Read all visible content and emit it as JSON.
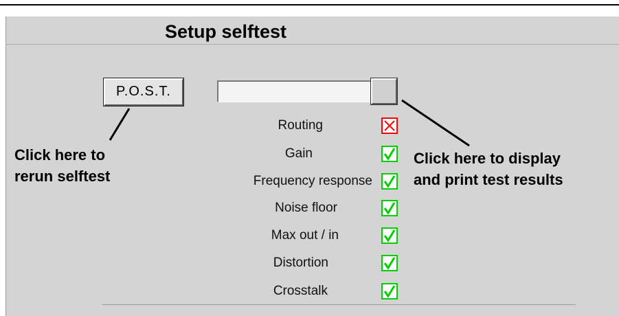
{
  "window": {
    "title": "Setup selftest"
  },
  "controls": {
    "post_button_label": "P.O.S.T.",
    "test_progress": 1.0
  },
  "tests": [
    {
      "label": "Routing",
      "status": "fail",
      "icon": "x-mark-icon",
      "color": "#ff0000"
    },
    {
      "label": "Gain",
      "status": "pass",
      "icon": "check-mark-icon",
      "color": "#00d000"
    },
    {
      "label": "Frequency response",
      "status": "pass",
      "icon": "check-mark-icon",
      "color": "#00d000"
    },
    {
      "label": "Noise floor",
      "status": "pass",
      "icon": "check-mark-icon",
      "color": "#00d000"
    },
    {
      "label": "Max out / in",
      "status": "pass",
      "icon": "check-mark-icon",
      "color": "#00d000"
    },
    {
      "label": "Distortion",
      "status": "pass",
      "icon": "check-mark-icon",
      "color": "#00d000"
    },
    {
      "label": "Crosstalk",
      "status": "pass",
      "icon": "check-mark-icon",
      "color": "#00d000"
    }
  ],
  "annotations": {
    "rerun_line1": "Click here to",
    "rerun_line2": "rerun selftest",
    "results_line1": "Click here to display",
    "results_line2": "and print test results"
  },
  "colors": {
    "panel_bg": "#d4d4d4",
    "fail": "#ff0000",
    "pass": "#00d000"
  }
}
